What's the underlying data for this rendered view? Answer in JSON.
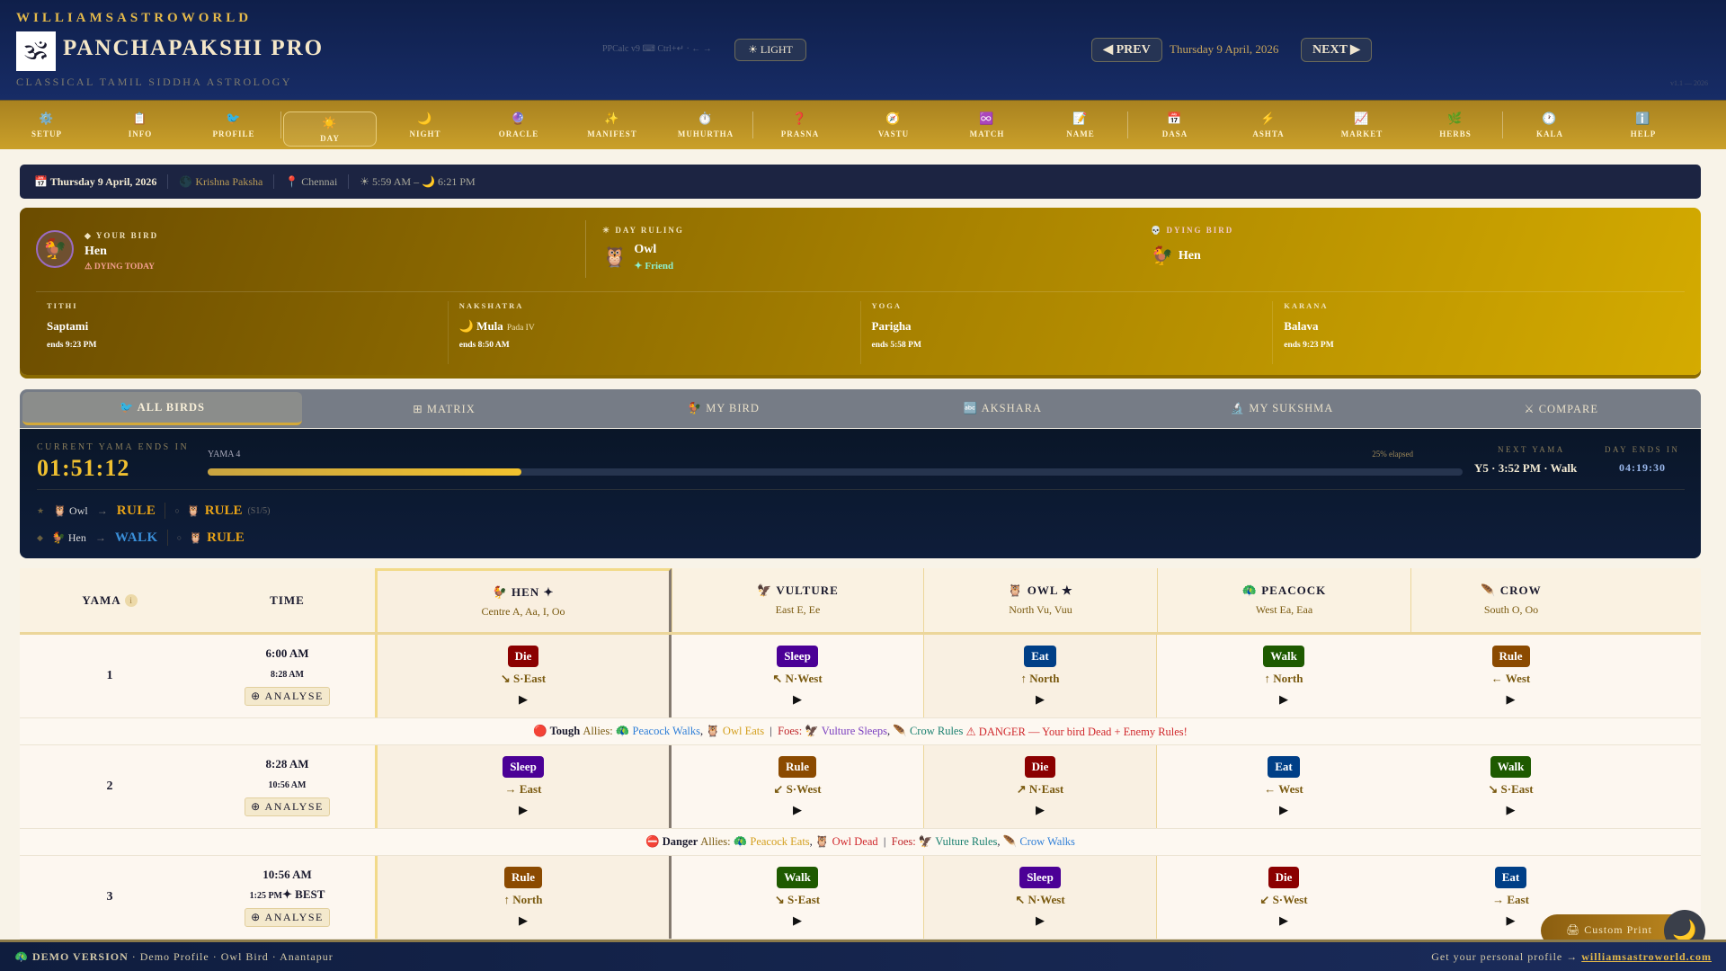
{
  "header": {
    "brand": "WILLIAMSASTROWORLD",
    "title": "PANCHAPAKSHI PRO",
    "tagline": "CLASSICAL TAMIL SIDDHA ASTROLOGY",
    "ppcalc": "PPCalc v9 ⌨ Ctrl+↵ · ← →",
    "light_btn": "☀ LIGHT",
    "prev_btn": "◀ PREV",
    "next_btn": "NEXT ▶",
    "date": "Thursday 9 April, 2026",
    "version": "v1.1 — 2026"
  },
  "nav": [
    {
      "icon": "⚙️",
      "label": "SETUP"
    },
    {
      "icon": "📋",
      "label": "INFO"
    },
    {
      "icon": "🐦",
      "label": "PROFILE"
    },
    {
      "icon": "☀️",
      "label": "DAY",
      "active": true
    },
    {
      "icon": "🌙",
      "label": "NIGHT"
    },
    {
      "icon": "🔮",
      "label": "ORACLE"
    },
    {
      "icon": "✨",
      "label": "MANIFEST"
    },
    {
      "icon": "⏱️",
      "label": "MUHURTHA"
    },
    {
      "icon": "❓",
      "label": "PRASNA"
    },
    {
      "icon": "🧭",
      "label": "VASTU"
    },
    {
      "icon": "♾️",
      "label": "MATCH"
    },
    {
      "icon": "📝",
      "label": "NAME"
    },
    {
      "icon": "📅",
      "label": "DASA"
    },
    {
      "icon": "⚡",
      "label": "ASHTA"
    },
    {
      "icon": "📈",
      "label": "MARKET"
    },
    {
      "icon": "🌿",
      "label": "HERBS"
    },
    {
      "icon": "🕐",
      "label": "KALA"
    },
    {
      "icon": "ℹ️",
      "label": "HELP"
    }
  ],
  "infobar": {
    "date": "📅 Thursday 9 April, 2026",
    "paksha": "🌑 Krishna Paksha",
    "place": "📍 Chennai",
    "sun": "☀ 5:59 AM – 🌙 6:21 PM"
  },
  "card": {
    "your_bird_label": "◆ YOUR BIRD",
    "your_bird": "Hen",
    "your_bird_icon": "🐓",
    "dying_today": "⚠ DYING TODAY",
    "day_ruling_label": "☀ DAY RULING",
    "day_ruling": "Owl",
    "day_ruling_icon": "🦉",
    "relation": "✦ Friend",
    "dying_label": "💀 DYING BIRD",
    "dying_bird": "Hen",
    "dying_icon": "🐓",
    "panchang": [
      {
        "label": "TITHI",
        "value": "Saptami",
        "extra": "",
        "ends": "ends 9:23 PM"
      },
      {
        "label": "NAKSHATRA",
        "value": "🌙 Mula",
        "extra": "Pada IV",
        "ends": "ends 8:50 AM"
      },
      {
        "label": "YOGA",
        "value": "Parigha",
        "extra": "",
        "ends": "ends 5:58 PM"
      },
      {
        "label": "KARANA",
        "value": "Balava",
        "extra": "",
        "ends": "ends 9:23 PM"
      }
    ]
  },
  "tabs": [
    "🐦 ALL BIRDS",
    "⊞ MATRIX",
    "🐓 MY BIRD",
    "🔤 AKSHARA",
    "🔬 MY SUKSHMA",
    "⚔ COMPARE"
  ],
  "yama": {
    "ends_label": "CURRENT YAMA ENDS IN",
    "countdown": "01:51:12",
    "yama_label": "YAMA 4",
    "elapsed_text": "25% elapsed",
    "progress": 0.25,
    "next_label": "NEXT YAMA",
    "next_value": "Y5 · 3:52 PM · Walk",
    "day_ends_label": "DAY ENDS IN",
    "day_ends": "04:19:30",
    "lines": [
      {
        "mark": "★",
        "icon": "🦉",
        "bird": "Owl",
        "act": "RULE",
        "act_color": "#e8a317",
        "sub_icon": "🦉",
        "sub_act": "RULE",
        "sub_note": "(S1/5)"
      },
      {
        "mark": "◆",
        "icon": "🐓",
        "bird": "Hen",
        "act": "WALK",
        "act_color": "#3a8fd8",
        "sub_icon": "🦉",
        "sub_act": "RULE",
        "sub_note": ""
      }
    ]
  },
  "table": {
    "yama_header": "YAMA",
    "info_icon": "i",
    "time_header": "TIME",
    "analyse": "⊕ ANALYSE",
    "birds": [
      {
        "name": "🐓 HEN ✦",
        "letters": "Centre A, Aa, I, Oo"
      },
      {
        "name": "🦅 VULTURE",
        "letters": "East E, Ee"
      },
      {
        "name": "🦉 OWL ★",
        "letters": "North Vu, Vuu"
      },
      {
        "name": "🦚 PEACOCK",
        "letters": "West Ea, Eaa"
      },
      {
        "name": "🪶 CROW",
        "letters": "South O, Oo"
      }
    ],
    "colors": {
      "Die": "#8b0000",
      "Sleep": "#4b0096",
      "Eat": "#003f87",
      "Walk": "#1e5a00",
      "Rule": "#8b4a00"
    },
    "rows": [
      {
        "yama": "1",
        "start": "6:00 AM",
        "end": "8:28 AM",
        "best": "",
        "cells": [
          [
            "Die",
            "↘ S·East"
          ],
          [
            "Sleep",
            "↖ N·West"
          ],
          [
            "Eat",
            "↑ North"
          ],
          [
            "Walk",
            "↑ North"
          ],
          [
            "Rule",
            "← West"
          ]
        ],
        "summary": [
          [
            "🔴 Tough ",
            "#1a1a2e"
          ],
          [
            "Allies: ",
            "#7a5a10"
          ],
          [
            "🦚 Peacock Walks",
            "#2f7fd8"
          ],
          [
            ", ",
            "#1a1a2e"
          ],
          [
            "🦉 Owl Eats",
            "#d4a020"
          ],
          [
            "  |  ",
            "#1a1a2e"
          ],
          [
            "Foes: ",
            "#c0282c"
          ],
          [
            "🦅 Vulture Sleeps",
            "#7b3fc0"
          ],
          [
            ", ",
            "#1a1a2e"
          ],
          [
            "🪶 Crow Rules",
            "#1a8070"
          ],
          [
            " ⚠ DANGER — Your bird Dead + Enemy Rules!",
            "#d0282c"
          ]
        ]
      },
      {
        "yama": "2",
        "start": "8:28 AM",
        "end": "10:56 AM",
        "best": "",
        "cells": [
          [
            "Sleep",
            "→ East"
          ],
          [
            "Rule",
            "↙ S·West"
          ],
          [
            "Die",
            "↗ N·East"
          ],
          [
            "Eat",
            "← West"
          ],
          [
            "Walk",
            "↘ S·East"
          ]
        ],
        "summary": [
          [
            "⛔ Danger ",
            "#1a1a2e"
          ],
          [
            "Allies: ",
            "#7a5a10"
          ],
          [
            "🦚 Peacock Eats",
            "#d4a020"
          ],
          [
            ", ",
            "#1a1a2e"
          ],
          [
            "🦉 Owl Dead",
            "#d0282c"
          ],
          [
            "  |  ",
            "#1a1a2e"
          ],
          [
            "Foes: ",
            "#c0282c"
          ],
          [
            "🦅 Vulture Rules",
            "#1a8070"
          ],
          [
            ", ",
            "#1a1a2e"
          ],
          [
            "🪶 Crow Walks",
            "#2f7fd8"
          ]
        ]
      },
      {
        "yama": "3",
        "start": "10:56 AM",
        "end": "1:25 PM",
        "best": "✦ BEST",
        "cells": [
          [
            "Rule",
            "↑ North"
          ],
          [
            "Walk",
            "↘ S·East"
          ],
          [
            "Sleep",
            "↖ N·West"
          ],
          [
            "Die",
            "↙ S·West"
          ],
          [
            "Eat",
            "→ East"
          ]
        ],
        "summary": []
      }
    ]
  },
  "footer": {
    "demo": "🦚 DEMO VERSION",
    "profile": "Demo Profile",
    "bird": "Owl Bird",
    "place": "Anantapur",
    "cta": "Get your personal profile →",
    "link": "williamsastroworld.com"
  },
  "fab": {
    "label": "🖨 Custom Print R...",
    "moon": "🌙"
  }
}
